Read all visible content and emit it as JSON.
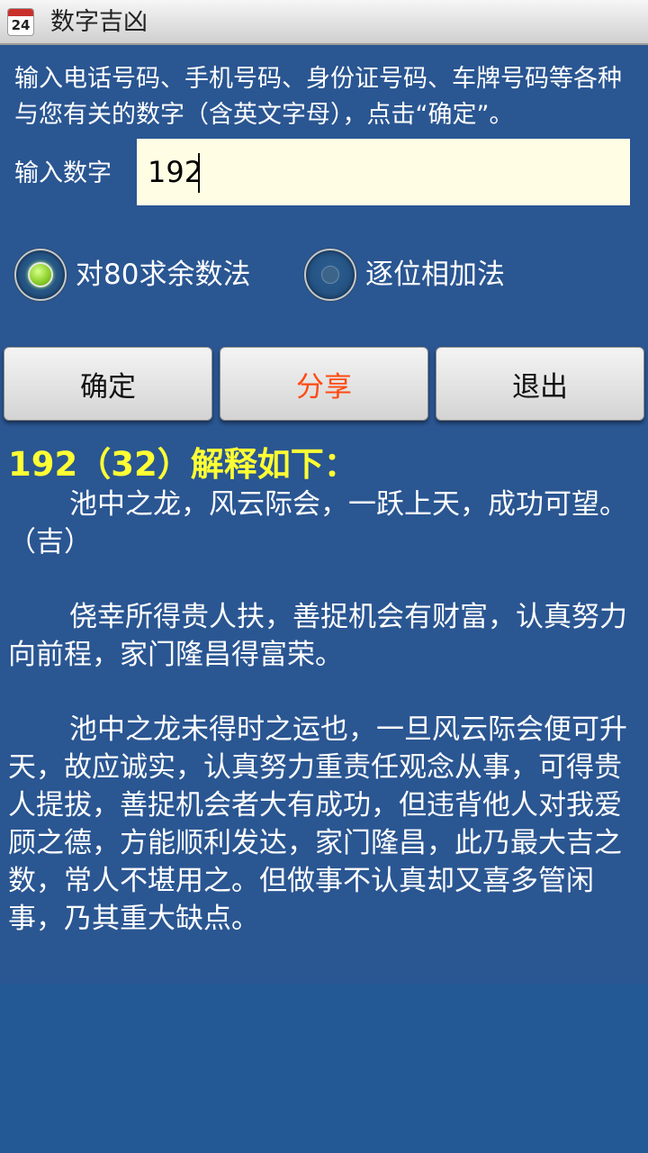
{
  "app": {
    "icon_day": "24",
    "title": "数字吉凶"
  },
  "intro": "输入电话号码、手机号码、身份证号码、车牌号码等各种与您有关的数字（含英文字母），点击“确定”。",
  "input": {
    "label": "输入数字",
    "value": "192"
  },
  "methods": [
    {
      "label": "对80求余数法",
      "selected": true
    },
    {
      "label": "逐位相加法",
      "selected": false
    }
  ],
  "buttons": {
    "confirm": "确定",
    "share": "分享",
    "exit": "退出"
  },
  "result": {
    "title": "192（32）解释如下：",
    "para1": "池中之龙，风云际会，一跃上天，成功可望。（吉）",
    "para2": "侥幸所得贵人扶，善捉机会有财富，认真努力向前程，家门隆昌得富荣。",
    "para3": "池中之龙未得时之运也，一旦风云际会便可升天，故应诚实，认真努力重责任观念从事，可得贵人提拔，善捉机会者大有成功，但违背他人对我爱顾之德，方能顺利发达，家门隆昌，此乃最大吉之数，常人不堪用之。但做事不认真却又喜多管闲事，乃其重大缺点。"
  },
  "colors": {
    "background": "#2a5692",
    "result_title": "#ffff33",
    "share_text": "#ff4a10",
    "input_bg": "#fffde4"
  }
}
